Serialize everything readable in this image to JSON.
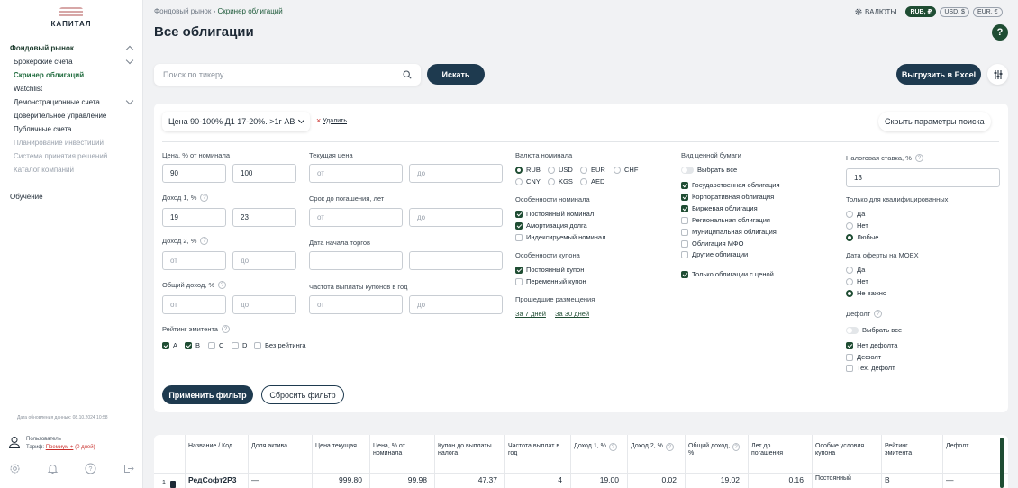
{
  "brand": {
    "name": "КАПИТАЛ"
  },
  "sidebar": {
    "items": [
      {
        "label": "Фондовый рынок",
        "level": 1,
        "state": "section",
        "chevron": "up"
      },
      {
        "label": "Брокерские счета",
        "level": 2,
        "state": "normal",
        "chevron": "down"
      },
      {
        "label": "Скринер облигаций",
        "level": 2,
        "state": "active",
        "chevron": ""
      },
      {
        "label": "Watchlist",
        "level": 2,
        "state": "normal",
        "chevron": ""
      },
      {
        "label": "Демонстрационные счета",
        "level": 2,
        "state": "normal",
        "chevron": "down"
      },
      {
        "label": "Доверительное управление",
        "level": 2,
        "state": "normal",
        "chevron": ""
      },
      {
        "label": "Публичные счета",
        "level": 2,
        "state": "normal",
        "chevron": ""
      },
      {
        "label": "Планирование инвестиций",
        "level": 2,
        "state": "muted",
        "chevron": ""
      },
      {
        "label": "Система принятия решений",
        "level": 2,
        "state": "muted",
        "chevron": ""
      },
      {
        "label": "Каталог компаний",
        "level": 2,
        "state": "muted",
        "chevron": ""
      }
    ],
    "learning": "Обучение",
    "updated": "Дата обновления данных: 08.10.2024 10:58",
    "user": {
      "name": "Пользователь",
      "tariff_label": "Тариф:",
      "tariff_link": "Премиум +",
      "days": "(0 дней)"
    },
    "footer_icons": [
      "settings-icon",
      "bell-icon",
      "help-icon",
      "logout-icon"
    ]
  },
  "breadcrumbs": {
    "root": "Фондовый рынок",
    "sep": "›",
    "current": "Скринер облигаций"
  },
  "page_title": "Все облигации",
  "currency": {
    "label": "ВАЛЮТЫ",
    "options": [
      {
        "label": "RUB, ₽",
        "active": true
      },
      {
        "label": "USD, $",
        "active": false
      },
      {
        "label": "EUR, €",
        "active": false
      }
    ]
  },
  "search": {
    "placeholder": "Поиск по тикеру",
    "button": "Искать"
  },
  "export_button": "Выгрузить в Excel",
  "filters": {
    "preset": "Цена 90-100% Д1 17-20%. >1г АВ",
    "delete": "Удалить",
    "hide": "Скрыть параметры поиска",
    "price_nominal": {
      "label": "Цена, % от номинала",
      "from": "90",
      "to": "100"
    },
    "income1": {
      "label": "Доход 1, %",
      "from": "19",
      "to": "23"
    },
    "income2": {
      "label": "Доход 2, %",
      "from": "от",
      "to": "до"
    },
    "total_income": {
      "label": "Общий доход, %",
      "from": "от",
      "to": "до"
    },
    "rating": {
      "label": "Рейтинг эмитента",
      "options": [
        {
          "label": "A",
          "checked": true
        },
        {
          "label": "B",
          "checked": true
        },
        {
          "label": "C",
          "checked": false
        },
        {
          "label": "D",
          "checked": false
        },
        {
          "label": "Без рейтинга",
          "checked": false
        }
      ]
    },
    "current_price": {
      "label": "Текущая цена",
      "from": "от",
      "to": "до"
    },
    "maturity": {
      "label": "Срок до погашения, лет",
      "from": "от",
      "to": "до"
    },
    "trade_start": {
      "label": "Дата начала торгов",
      "from": "",
      "to": ""
    },
    "coupon_freq": {
      "label": "Частота выплаты купонов в год",
      "from": "от",
      "to": "до"
    },
    "nominal_currency": {
      "label": "Валюта номинала",
      "options": [
        {
          "label": "RUB",
          "on": true
        },
        {
          "label": "USD",
          "on": false
        },
        {
          "label": "EUR",
          "on": false
        },
        {
          "label": "CHF",
          "on": false
        },
        {
          "label": "CNY",
          "on": false
        },
        {
          "label": "KGS",
          "on": false
        },
        {
          "label": "AED",
          "on": false
        }
      ]
    },
    "nominal_features": {
      "label": "Особенности номинала",
      "options": [
        {
          "label": "Постоянный номинал",
          "checked": true
        },
        {
          "label": "Амортизация долга",
          "checked": true
        },
        {
          "label": "Индексируемый номинал",
          "checked": false
        }
      ]
    },
    "coupon_features": {
      "label": "Особенности купона",
      "options": [
        {
          "label": "Постоянный купон",
          "checked": true
        },
        {
          "label": "Переменный купон",
          "checked": false
        }
      ]
    },
    "past_placements": {
      "label": "Прошедшие размещения",
      "links": [
        "За 7 дней",
        "За 30 дней"
      ]
    },
    "security_type": {
      "label": "Вид ценной бумаги",
      "select_all": "Выбрать все",
      "options": [
        {
          "label": "Государственная облигация",
          "checked": true
        },
        {
          "label": "Корпоративная облигация",
          "checked": true
        },
        {
          "label": "Биржевая облигация",
          "checked": true
        },
        {
          "label": "Региональная облигация",
          "checked": false
        },
        {
          "label": "Муниципальная облигация",
          "checked": false
        },
        {
          "label": "Облигация МФО",
          "checked": false
        },
        {
          "label": "Другие облигации",
          "checked": false
        }
      ],
      "with_price": {
        "label": "Только облигации с ценой",
        "checked": true
      }
    },
    "tax_rate": {
      "label": "Налоговая ставка, %",
      "value": "13"
    },
    "qualified": {
      "label": "Только для квалифицированных",
      "options": [
        {
          "label": "Да",
          "on": false
        },
        {
          "label": "Нет",
          "on": false
        },
        {
          "label": "Любые",
          "on": true
        }
      ]
    },
    "offer_date": {
      "label": "Дата оферты на МОЕХ",
      "options": [
        {
          "label": "Да",
          "on": false
        },
        {
          "label": "Нет",
          "on": false
        },
        {
          "label": "Не важно",
          "on": true
        }
      ]
    },
    "default": {
      "label": "Дефолт",
      "select_all": "Выбрать все",
      "options": [
        {
          "label": "Нет дефолта",
          "checked": true
        },
        {
          "label": "Дефолт",
          "checked": false
        },
        {
          "label": "Тех. дефолт",
          "checked": false
        }
      ]
    },
    "apply": "Применить фильтр",
    "reset": "Сбросить фильтр"
  },
  "table": {
    "headers": [
      "Название / Код",
      "Доля актива",
      "Цена текущая",
      "Цена, % от номинала",
      "Купон до выплаты налога",
      "Частота выплат в год",
      "Доход 1, %",
      "Доход 2, %",
      "Общий доход, %",
      "Лет до погашения",
      "Особые условия купона",
      "Рейтинг эмитента",
      "Дефолт"
    ],
    "rows": [
      {
        "num": "1",
        "name": "РедСофт2Р3",
        "share": "—",
        "price": "999,80",
        "pct_nominal": "99,98",
        "coupon": "47,37",
        "freq": "4",
        "income1": "19,00",
        "income2": "0,02",
        "total": "19,02",
        "years": "0,16",
        "special": "Постоянный",
        "rating": "B",
        "default": "—"
      }
    ]
  },
  "colors": {
    "accent": "#1f4d33",
    "dark_button": "#1e3a4f",
    "danger": "#c9302c"
  }
}
